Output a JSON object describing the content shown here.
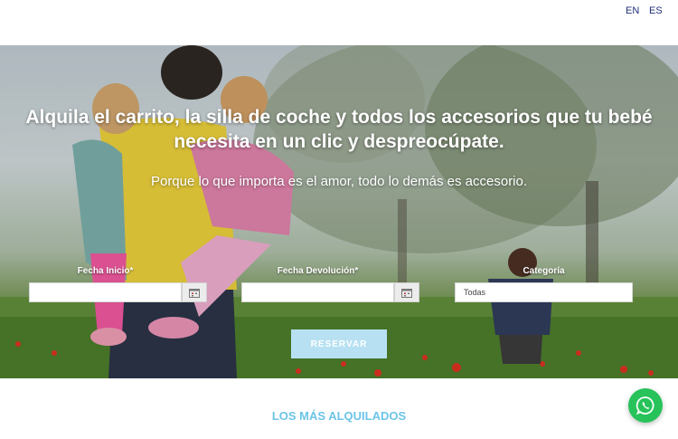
{
  "header": {
    "languages": [
      {
        "code": "EN"
      },
      {
        "code": "ES"
      }
    ]
  },
  "hero": {
    "headline": "Alquila el carrito, la silla de coche y todos los accesorios que tu bebé necesita en un clic y despreocúpate.",
    "subheadline": "Porque lo que importa es el amor, todo lo demás es accesorio."
  },
  "form": {
    "start_date_label": "Fecha Inicio*",
    "start_date_value": "",
    "return_date_label": "Fecha Devolución*",
    "return_date_value": "",
    "category_label": "Categoría",
    "category_selected": "Todas",
    "submit_label": "RESERVAR"
  },
  "sections": {
    "most_rented_title": "LOS MÁS ALQUILADOS"
  },
  "icons": {
    "calendar": "calendar-icon",
    "whatsapp": "whatsapp-icon"
  },
  "colors": {
    "accent": "#6cc4e8",
    "button": "#b7e1f2",
    "whatsapp": "#27c35a",
    "lang_link": "#1f2f7a"
  }
}
